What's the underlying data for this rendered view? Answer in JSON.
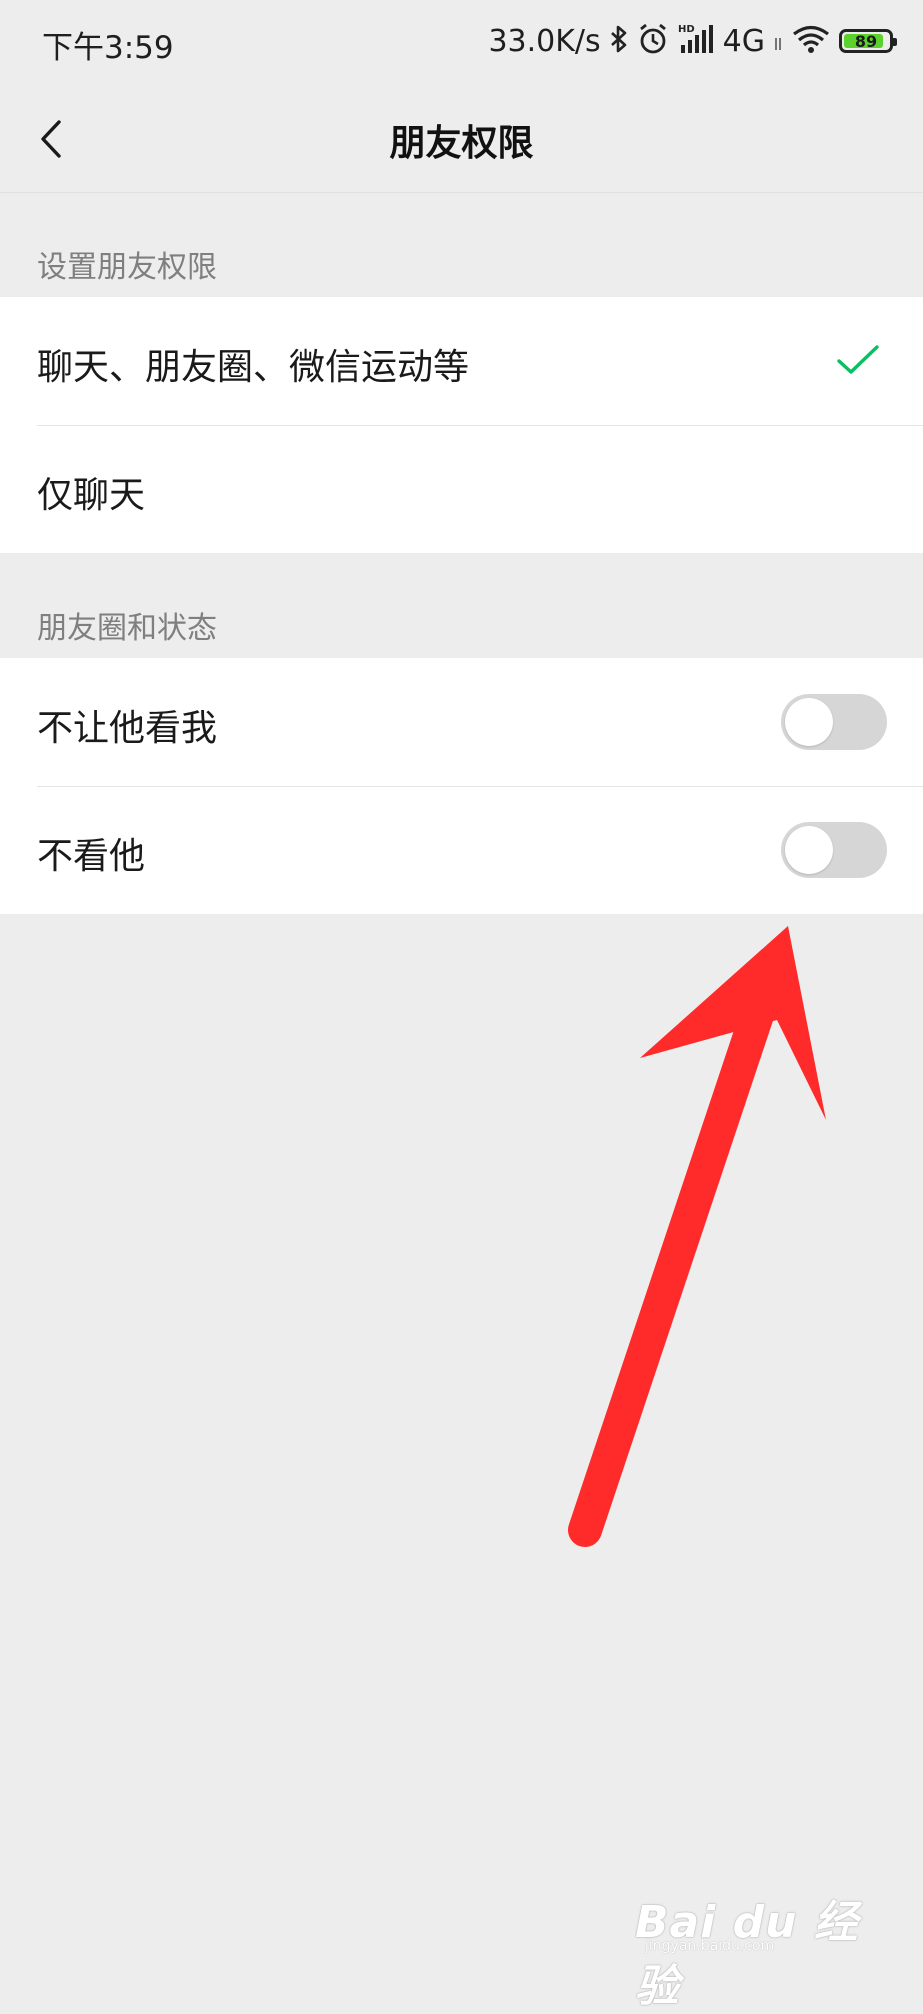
{
  "status_bar": {
    "time": "下午3:59",
    "net_speed": "33.0K/s",
    "network": "4G",
    "hd_label": "HD",
    "battery": "89",
    "icons": [
      "bluetooth-icon",
      "alarm-icon",
      "signal-icon",
      "wifi-icon",
      "battery-icon"
    ]
  },
  "nav": {
    "title": "朋友权限",
    "back_icon": "chevron-left-icon"
  },
  "sections": [
    {
      "label": "设置朋友权限",
      "items": [
        {
          "label": "聊天、朋友圈、微信运动等",
          "checked": true
        },
        {
          "label": "仅聊天",
          "checked": false
        }
      ]
    },
    {
      "label": "朋友圈和状态",
      "items": [
        {
          "label": "不让他看我",
          "toggle_on": false
        },
        {
          "label": "不看他",
          "toggle_on": false
        }
      ]
    }
  ],
  "colors": {
    "background": "#ededed",
    "check": "#07c160",
    "toggle_off": "#d6d6d6",
    "annotation_arrow": "#ff2b2b",
    "battery_fill": "#5cd12d"
  },
  "watermark": {
    "logo": "Bai du 经验",
    "url": "jingyan.baidu.com"
  }
}
